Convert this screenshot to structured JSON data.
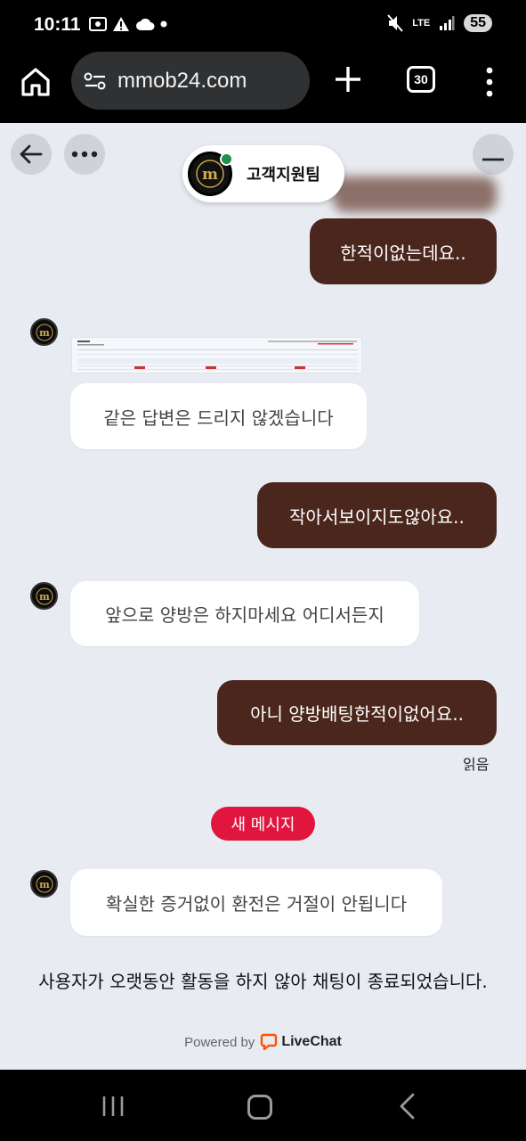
{
  "status_bar": {
    "time": "10:11",
    "battery": "55",
    "network": "LTE"
  },
  "browser": {
    "url": "mmob24.com",
    "tab_count": "30"
  },
  "chat": {
    "agent_name": "고객지원팀",
    "agent_logo_letter": "m",
    "messages": [
      {
        "direction": "out",
        "text": "한적이없는데요.."
      },
      {
        "direction": "in",
        "text": "같은 답변은 드리지 않겠습니다"
      },
      {
        "direction": "out",
        "text": "작아서보이지도않아요.."
      },
      {
        "direction": "in",
        "text": "앞으로 양방은 하지마세요 어디서든지"
      },
      {
        "direction": "out",
        "text": "아니 양방배팅한적이없어요.."
      },
      {
        "direction": "in",
        "text": "확실한 증거없이 환전은 거절이 안됩니다"
      }
    ],
    "read_status": "읽음",
    "new_message_label": "새 메시지",
    "end_note": "사용자가 오랫동안 활동을 하지 않아 채팅이 종료되었습니다.",
    "powered_by": "Powered by",
    "brand": "LiveChat"
  },
  "colors": {
    "outgoing_bubble": "#4a261d",
    "incoming_bubble": "#ffffff",
    "chat_background": "#e8ecf2",
    "new_message_badge": "#e0163f",
    "online_status": "#1e8f4e",
    "livechat_brand": "#ff5100"
  }
}
